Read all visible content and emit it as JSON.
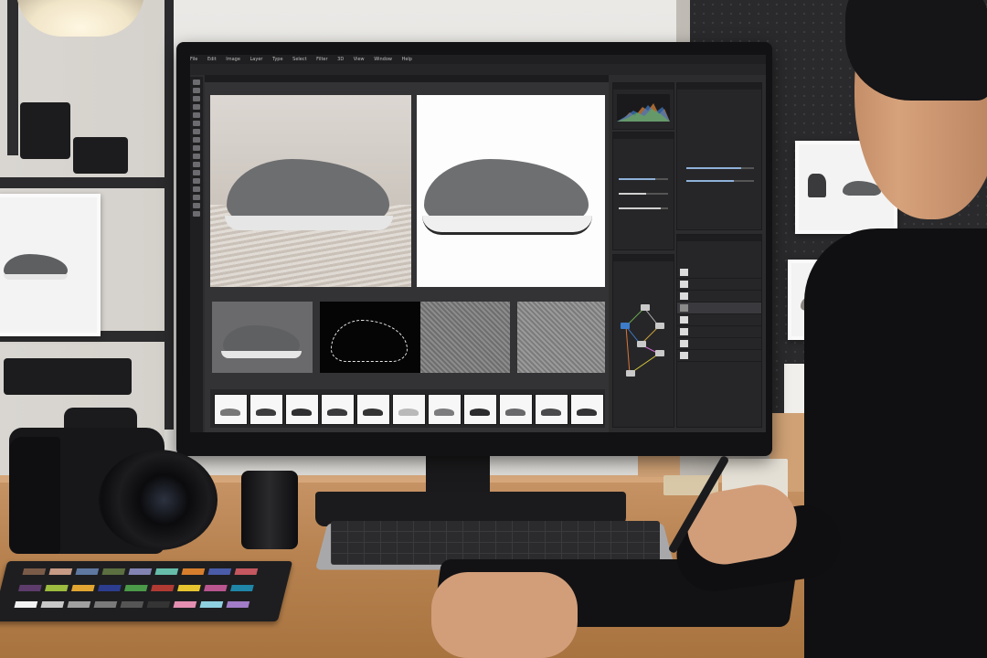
{
  "scene": "photographer retouching sneaker product photo at desk",
  "screen": {
    "menu_items": [
      "File",
      "Edit",
      "Image",
      "Layer",
      "Type",
      "Select",
      "Filter",
      "3D",
      "View",
      "Window",
      "Help"
    ],
    "document_tab": "",
    "section_labels": {
      "steps": "",
      "filmstrip": ""
    },
    "panels": {
      "histogram": "",
      "adjustments": "",
      "layers": "",
      "node_graph": ""
    },
    "layer_names": [
      "",
      "",
      "",
      "",
      "",
      "",
      "",
      ""
    ],
    "accent_color": "#3d7cc9"
  },
  "colors": {
    "desk": "#b7824f",
    "screen_bg": "#2c2c2e",
    "shoe_gray": "#6b6d70"
  }
}
